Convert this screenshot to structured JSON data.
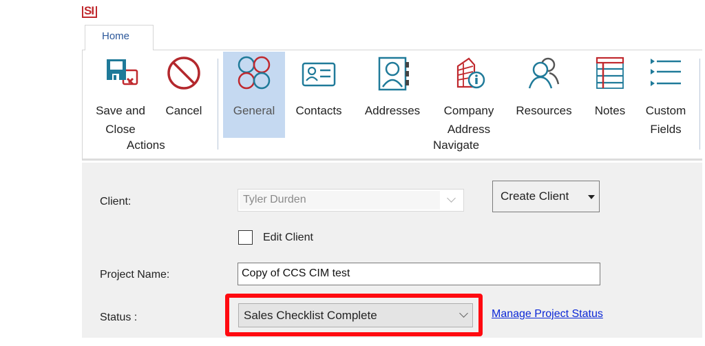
{
  "app": {
    "logo_text": "SI"
  },
  "tabs": [
    {
      "label": "Home",
      "active": true
    }
  ],
  "ribbon": {
    "groups": [
      {
        "label": "Actions"
      },
      {
        "label": "Navigate"
      }
    ],
    "buttons": [
      {
        "label": "Save and\nClose",
        "icon": "save-close-icon",
        "group": "Actions"
      },
      {
        "label": "Cancel",
        "icon": "cancel-icon",
        "group": "Actions"
      },
      {
        "label": "General",
        "icon": "general-icon",
        "group": "Navigate",
        "active": true
      },
      {
        "label": "Contacts",
        "icon": "contact-card-icon",
        "group": "Navigate"
      },
      {
        "label": "Addresses",
        "icon": "address-book-icon",
        "group": "Navigate"
      },
      {
        "label": "Company\nAddress",
        "icon": "company-info-icon",
        "group": "Navigate"
      },
      {
        "label": "Resources",
        "icon": "people-icon",
        "group": "Navigate"
      },
      {
        "label": "Notes",
        "icon": "notes-icon",
        "group": "Navigate"
      },
      {
        "label": "Custom\nFields",
        "icon": "list-icon",
        "group": "Navigate"
      }
    ]
  },
  "form": {
    "client": {
      "label": "Client:",
      "value": "Tyler Durden",
      "disabled": true
    },
    "create_client": {
      "label": "Create Client"
    },
    "edit_client": {
      "label": "Edit Client",
      "checked": false
    },
    "project_name": {
      "label": "Project Name:",
      "value": "Copy of CCS CIM test"
    },
    "status": {
      "label": "Status :",
      "value": "Sales Checklist Complete"
    },
    "manage_status_link": "Manage Project Status"
  },
  "colors": {
    "accent_red": "#c0282d",
    "accent_teal": "#1f7a99",
    "highlight_box": "#ff0a10",
    "link": "#0b27d6",
    "active_button": "#c5d9f1"
  }
}
